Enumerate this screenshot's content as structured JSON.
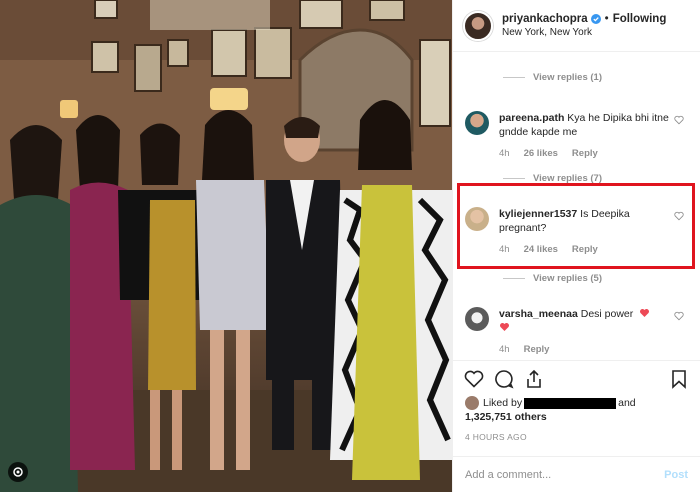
{
  "post": {
    "username": "priyankachopra",
    "follow_state": "Following",
    "location": "New York, New York"
  },
  "comments": {
    "view_replies_1": "View replies (1)",
    "view_replies_7": "View replies (7)",
    "view_replies_5": "View replies (5)",
    "view_replies_last": "View replies",
    "items": [
      {
        "user": "pareena.path",
        "text": "Kya he Dipika bhi itne gndde kapde me",
        "time": "4h",
        "likes": "26 likes",
        "reply": "Reply"
      },
      {
        "user": "kyliejenner1537",
        "text": "Is Deepika pregnant?",
        "time": "4h",
        "likes": "24 likes",
        "reply": "Reply"
      },
      {
        "user": "varsha_meenaa",
        "text": "Desi power",
        "time": "4h",
        "likes": "",
        "reply": "Reply"
      }
    ]
  },
  "likes": {
    "prefix": "Liked by",
    "suffix": "and",
    "count": "1,325,751 others"
  },
  "timestamp": "4 HOURS AGO",
  "add_comment": {
    "placeholder": "Add a comment...",
    "post_label": "Post"
  },
  "colors": {
    "highlight": "#e0141e",
    "heart_red": "#ed4956",
    "verified_blue": "#3897f0",
    "post_disabled": "#b2dffc"
  },
  "icons": [
    "heart-icon",
    "comment-icon",
    "share-icon",
    "bookmark-icon",
    "verified-icon",
    "gallery-icon"
  ]
}
